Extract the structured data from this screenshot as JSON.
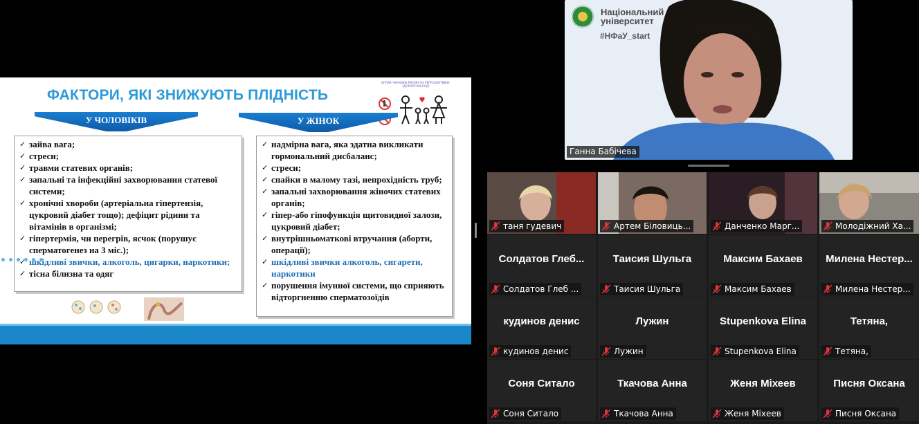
{
  "slide": {
    "title": "ФАКТОРИ, ЯКІ ЗНИЖУЮТЬ ПЛІДНІСТЬ",
    "note": "ВПЛИВ ЧИННИКІВ РИЗИКУ НА РЕПРОДУКТИВНЕ ЗДОРОВ'Я МОЛОДІ",
    "men_header": "У ЧОЛОВІКІВ",
    "women_header": "У ЖІНОК",
    "men_items": [
      {
        "text": "зайва вага;",
        "blue": false
      },
      {
        "text": "стреси;",
        "blue": false
      },
      {
        "text": "травми статевих органів;",
        "blue": false
      },
      {
        "text": "запальні та інфекційні захворювання статевої системи;",
        "blue": false
      },
      {
        "text": "хронічні хвороби (артеріальна гіпертензія, цукровий діабет тощо); дефіцит рідини та вітамінів в організмі;",
        "blue": false
      },
      {
        "text": "гіпертермія, чи перегрів, ясчок (порушує сперматогенез на 3 міс.);",
        "blue": false
      },
      {
        "text": "шкідливі звички, алкоголь, цигарки, наркотики;",
        "blue": true
      },
      {
        "text": "тісна білизна та одяг",
        "blue": false
      }
    ],
    "women_items": [
      {
        "text": "надмірна вага, яка здатна викликати гормональний дисбаланс;",
        "blue": false
      },
      {
        "text": "стреси;",
        "blue": false
      },
      {
        "text": "спайки в малому тазі, непрохідність труб;",
        "blue": false
      },
      {
        "text": "запальні захворювання жіночих статевих органів;",
        "blue": false
      },
      {
        "text": "гіпер-або гіпофункція щитовидної залози, цукровий діабет;",
        "blue": false
      },
      {
        "text": "внутрішньоматкові втручання (аборти, операції);",
        "blue": false
      },
      {
        "text": "шкідливі звички алкоголь, сигарети, наркотики",
        "blue": true
      },
      {
        "text": "порушення імунної системи, що сприяють відторгненню сперматозоїдів",
        "blue": false
      }
    ]
  },
  "speaker": {
    "university_line1": "Національний фа",
    "university_line2": "університет",
    "hashtag": "#НФаУ_start",
    "name": "Ганна Бабічева"
  },
  "participants_video": [
    {
      "label": "таня гудевич",
      "bg": "#5a4a44"
    },
    {
      "label": "Артем Біловиць...",
      "bg": "#6a5a52"
    },
    {
      "label": "Данченко Марг...",
      "bg": "#3a2a30"
    },
    {
      "label": "Молодіжний Ха...",
      "bg": "#6b6a66"
    }
  ],
  "participants_names": [
    {
      "name": "Солдатов  Глеб...",
      "label": "Солдатов Глеб ..."
    },
    {
      "name": "Таисия Шульга",
      "label": "Таисия Шульга"
    },
    {
      "name": "Максим Бахаев",
      "label": "Максим Бахаев"
    },
    {
      "name": "Милена  Нестер...",
      "label": "Милена Нестер..."
    },
    {
      "name": "кудинов денис",
      "label": "кудинов денис"
    },
    {
      "name": "Лужин",
      "label": "Лужин"
    },
    {
      "name": "Stupenkova Elina",
      "label": "Stupenkova Elina"
    },
    {
      "name": "Тетяна,",
      "label": "Тетяна,"
    },
    {
      "name": "Соня Ситало",
      "label": "Соня Ситало"
    },
    {
      "name": "Ткачова Анна",
      "label": "Ткачова Анна"
    },
    {
      "name": "Женя Міхеев",
      "label": "Женя Міхеев"
    },
    {
      "name": "Писня Оксана",
      "label": "Писня Оксана"
    }
  ],
  "icons": {
    "mic_muted": "mic-muted-icon"
  },
  "colors": {
    "accent_blue": "#2a9ad8",
    "mute_red": "#e0343c"
  }
}
